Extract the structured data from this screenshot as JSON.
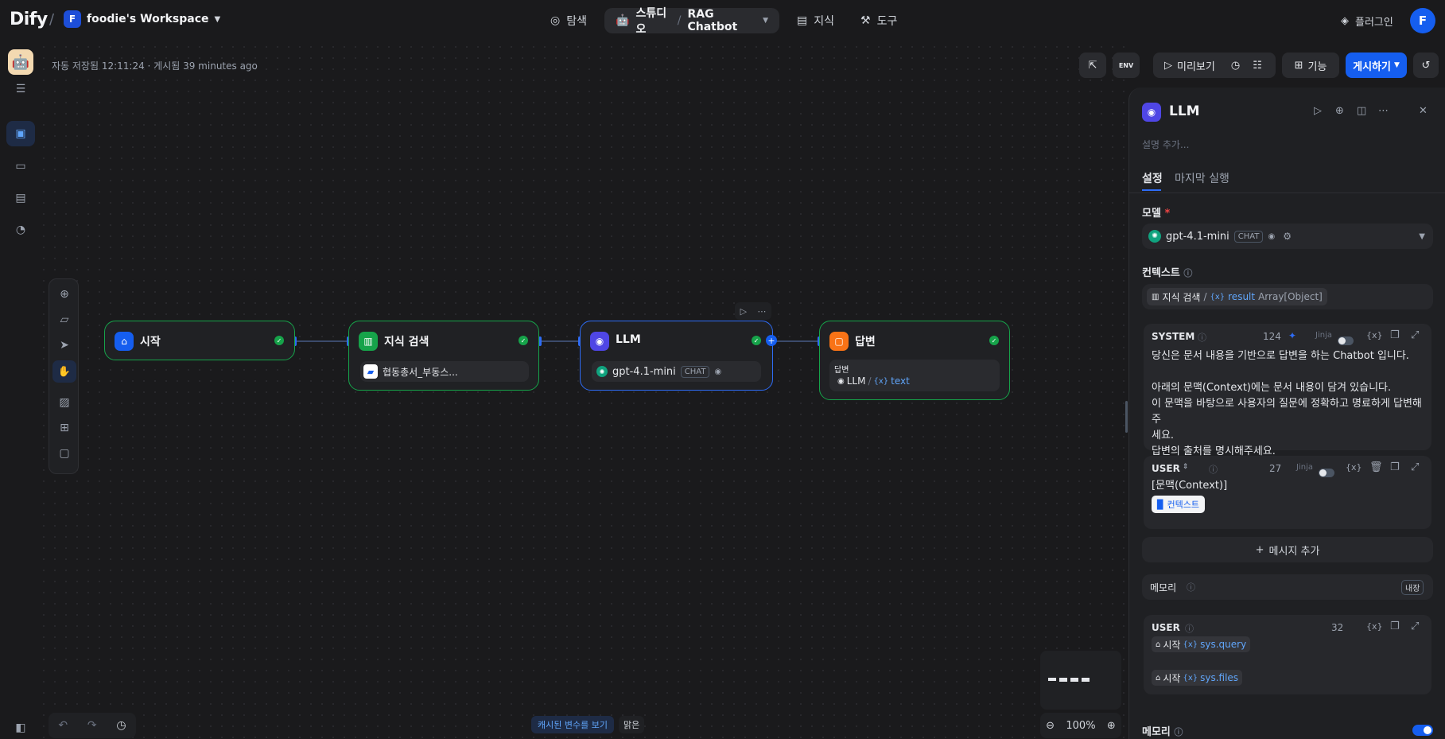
{
  "header": {
    "logo": "Dify",
    "workspace_initial": "F",
    "workspace_name": "foodie's Workspace",
    "nav": {
      "explore": "탐색",
      "studio": "스튜디오",
      "app_name": "RAG Chatbot",
      "knowledge": "지식",
      "tools": "도구"
    },
    "plugins": "플러그인",
    "user_initial": "F"
  },
  "status": {
    "autosave": "자동 저장됨 12:11:24 · 게시됨 39 minutes ago"
  },
  "toolbar": {
    "env": "ENV",
    "preview": "미리보기",
    "features": "기능",
    "publish": "게시하기"
  },
  "nodes": {
    "start": {
      "title": "시작"
    },
    "knowledge": {
      "title": "지식 검색",
      "dataset": "협동총서_부동스..."
    },
    "llm": {
      "title": "LLM",
      "model": "gpt-4.1-mini",
      "model_tag": "CHAT"
    },
    "answer": {
      "title": "답변",
      "label": "답변",
      "var_node": "LLM",
      "var_name": "text"
    }
  },
  "bottom": {
    "cached_vars": "캐시된 변수를 보기",
    "clear": "맑은",
    "zoom": "100%"
  },
  "panel": {
    "title": "LLM",
    "desc_placeholder": "설명 추가...",
    "tabs": {
      "settings": "설정",
      "last_run": "마지막 실행"
    },
    "model_label": "모델",
    "required_mark": "*",
    "model_name": "gpt-4.1-mini",
    "model_tag": "CHAT",
    "context_label": "컨텍스트",
    "context_node": "지식 검색",
    "context_sep": "/",
    "context_var": "result",
    "context_type": "Array[Object]",
    "system": {
      "role": "SYSTEM",
      "count": "124",
      "jinja": "Jinja",
      "line1": "당신은 문서 내용을 기반으로 답변을 하는 Chatbot 입니다.",
      "line2": "아래의 문맥(Context)에는 문서 내용이 담겨 있습니다.",
      "line3": "이 문맥을 바탕으로 사용자의 질문에 정확하고 명료하게 답변해주",
      "line4": "세요.",
      "line5": "답변의 출처를 명시해주세요."
    },
    "user": {
      "role": "USER",
      "count": "27",
      "jinja": "Jinja",
      "line1": "[문맥(Context)]",
      "chip": "컨텍스트"
    },
    "add_message": "메시지 추가",
    "memory_label": "메모리",
    "memory_badge": "내장",
    "user2": {
      "role": "USER",
      "count": "32",
      "node": "시작",
      "var1": "sys.query",
      "var2": "sys.files"
    },
    "memory_label2": "메모리"
  },
  "colors": {
    "accent": "#155eef",
    "success": "#16a34a",
    "canvas": "#1a1a1c"
  }
}
